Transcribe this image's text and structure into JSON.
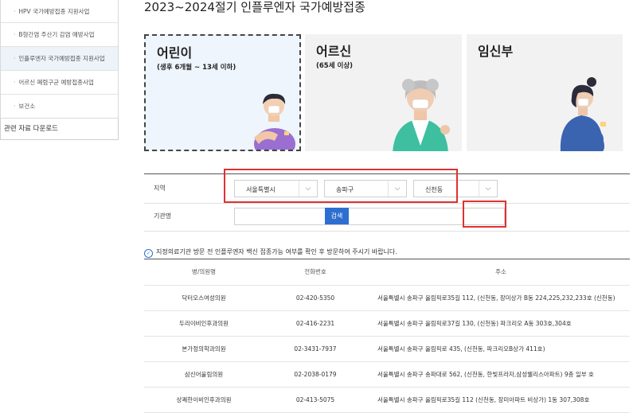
{
  "sidebar": {
    "items": [
      {
        "label": "HPV 국가예방접종 지원사업",
        "active": false
      },
      {
        "label": "B형간염 주산기 감염 예방사업",
        "active": false
      },
      {
        "label": "인플루엔자 국가예방접종 지원사업",
        "active": true
      },
      {
        "label": "어르신 폐렴구균 예방접종사업",
        "active": false
      },
      {
        "label": "보건소",
        "active": false
      }
    ],
    "download_label": "관련 자료 다운로드"
  },
  "page": {
    "title": "2023~2024절기 인플루엔자 국가예방접종"
  },
  "cards": [
    {
      "title": "어린이",
      "subtitle": "(생후 6개월 ~ 13세 이하)",
      "selected": true
    },
    {
      "title": "어르신",
      "subtitle": "(65세 이상)",
      "selected": false
    },
    {
      "title": "임신부",
      "subtitle": "",
      "selected": false
    }
  ],
  "search": {
    "region_label": "지역",
    "sido": "서울특별시",
    "sigungu": "송파구",
    "dong": "신천동",
    "institution_label": "기관명",
    "institution_value": "",
    "search_button": "검색"
  },
  "notice": "지정의료기관 방문 전 인플루엔자 백신 접종가능 여부를 확인 후 방문하여 주시기 바랍니다.",
  "table": {
    "headers": [
      "병/의원명",
      "전화번호",
      "주소"
    ],
    "rows": [
      {
        "name": "닥터오스여성의원",
        "phone": "02-420-5350",
        "address": "서울특별시 송파구 올림픽로35길 112, (신천동, 장미상가 B동 224,225,232,233호 (신천동)"
      },
      {
        "name": "두리이비인후과의원",
        "phone": "02-416-2231",
        "address": "서울특별시 송파구 올림픽로37길 130, (신천동) 파크리오 A동 303호,304호"
      },
      {
        "name": "본가정의학과의원",
        "phone": "02-3431-7937",
        "address": "서울특별시 송파구 올림픽로 435, (신천동, 파크리오B상가 411호)"
      },
      {
        "name": "삼신어울림의원",
        "phone": "02-2038-0179",
        "address": "서울특별시 송파구 송파대로 562, (신천동, 한빛프라자,삼성웰리스아파트) 9층 일부 호"
      },
      {
        "name": "상쾌한이비인후과의원",
        "phone": "02-413-5075",
        "address": "서울특별시 송파구 올림픽로35길 112 (신천동, 장미아파트 비상가) 1동 307,308호"
      }
    ]
  }
}
